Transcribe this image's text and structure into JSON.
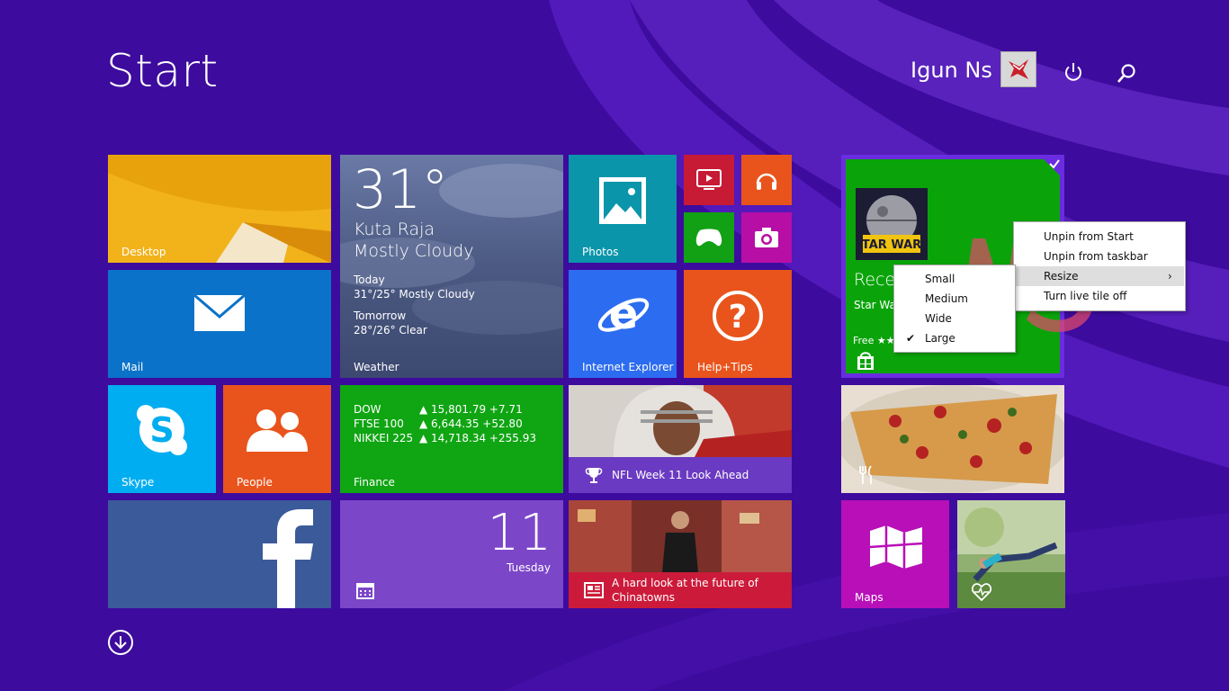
{
  "screen": {
    "title": "Start"
  },
  "user": {
    "name": "Igun Ns"
  },
  "icons": {
    "power": "power-icon",
    "search": "search-icon",
    "apps_arrow": "down-arrow-circle-icon"
  },
  "colors": {
    "background": "#3d0b9e",
    "desktop": "#e8a30c",
    "mail": "#0a72c8",
    "weather": "#4f5e86",
    "photos": "#0a95aa",
    "video": "#c71a35",
    "music": "#e9541c",
    "games": "#12a014",
    "camera": "#b70fa5",
    "ie": "#2c6cf0",
    "help": "#e9541c",
    "skype": "#00adf0",
    "people": "#e9541c",
    "finance": "#10a513",
    "sport": "#6b3ac2",
    "facebook": "#3b5a9a",
    "calendar": "#7c46c9",
    "news": "#cc1b3a",
    "maps": "#b80fb8",
    "store_tile": "#0aa40a",
    "selection": "#6a2ce0"
  },
  "tiles": {
    "desktop": {
      "label": "Desktop"
    },
    "mail": {
      "label": "Mail"
    },
    "weather": {
      "label": "Weather",
      "temp": "31°",
      "city": "Kuta Raja",
      "condition": "Mostly Cloudy",
      "today_label": "Today",
      "today_forecast": "31°/25° Mostly Cloudy",
      "tomorrow_label": "Tomorrow",
      "tomorrow_forecast": "28°/26° Clear"
    },
    "photos": {
      "label": "Photos"
    },
    "internet_explorer": {
      "label": "Internet Explorer"
    },
    "help_tips": {
      "label": "Help+Tips"
    },
    "skype": {
      "label": "Skype"
    },
    "people": {
      "label": "People"
    },
    "finance": {
      "label": "Finance",
      "rows": [
        {
          "name": "DOW",
          "value": "▲ 15,801.79 +7.71"
        },
        {
          "name": "FTSE 100",
          "value": "▲ 6,644.35 +52.80"
        },
        {
          "name": "NIKKEI 225",
          "value": "▲ 14,718.34 +255.93"
        }
      ]
    },
    "sport": {
      "headline": "NFL Week 11 Look Ahead"
    },
    "calendar": {
      "day": "11",
      "weekday": "Tuesday"
    },
    "news": {
      "headline_line1": "A hard look at the future of",
      "headline_line2": "Chinatowns"
    },
    "maps": {
      "label": "Maps"
    },
    "store": {
      "title_partial": "Rece",
      "subtitle_partial": "Star Wa",
      "price_partial": "Free ★★"
    }
  },
  "context_menu": {
    "items": [
      {
        "label": "Unpin from Start"
      },
      {
        "label": "Unpin from taskbar"
      },
      {
        "label": "Resize",
        "submenu_glyph": "›"
      },
      {
        "label": "Turn live tile off"
      }
    ]
  },
  "resize_submenu": {
    "items": [
      {
        "label": "Small"
      },
      {
        "label": "Medium"
      },
      {
        "label": "Wide"
      },
      {
        "label": "Large",
        "checked": true
      }
    ],
    "check_glyph": "✔"
  }
}
